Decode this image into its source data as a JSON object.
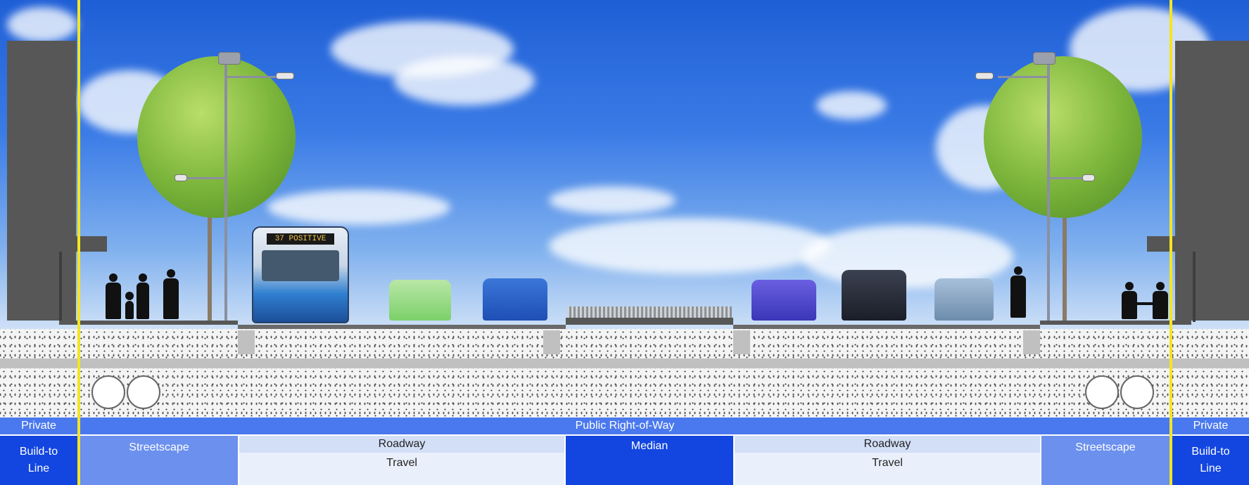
{
  "labels": {
    "private_left": "Private",
    "private_right": "Private",
    "public_row": "Public Right-of-Way",
    "build_to_line_left": [
      "Build-to",
      "Line"
    ],
    "build_to_line_right": [
      "Build-to",
      "Line"
    ],
    "streetscape_left": "Streetscape",
    "streetscape_right": "Streetscape",
    "roadway_left": {
      "title": "Roadway",
      "sub": "Travel"
    },
    "median": "Median",
    "roadway_right": {
      "title": "Roadway",
      "sub": "Travel"
    }
  },
  "bus_sign": "37 POSITIVE",
  "colors": {
    "dark_blue": "#1346e0",
    "bright_blue": "#4a78ee",
    "mid_blue": "#6b90ee",
    "light_blue": "#d3dff7",
    "pale_blue": "#eaf0fb",
    "build_line": "#f4e522",
    "building": "#575757"
  }
}
